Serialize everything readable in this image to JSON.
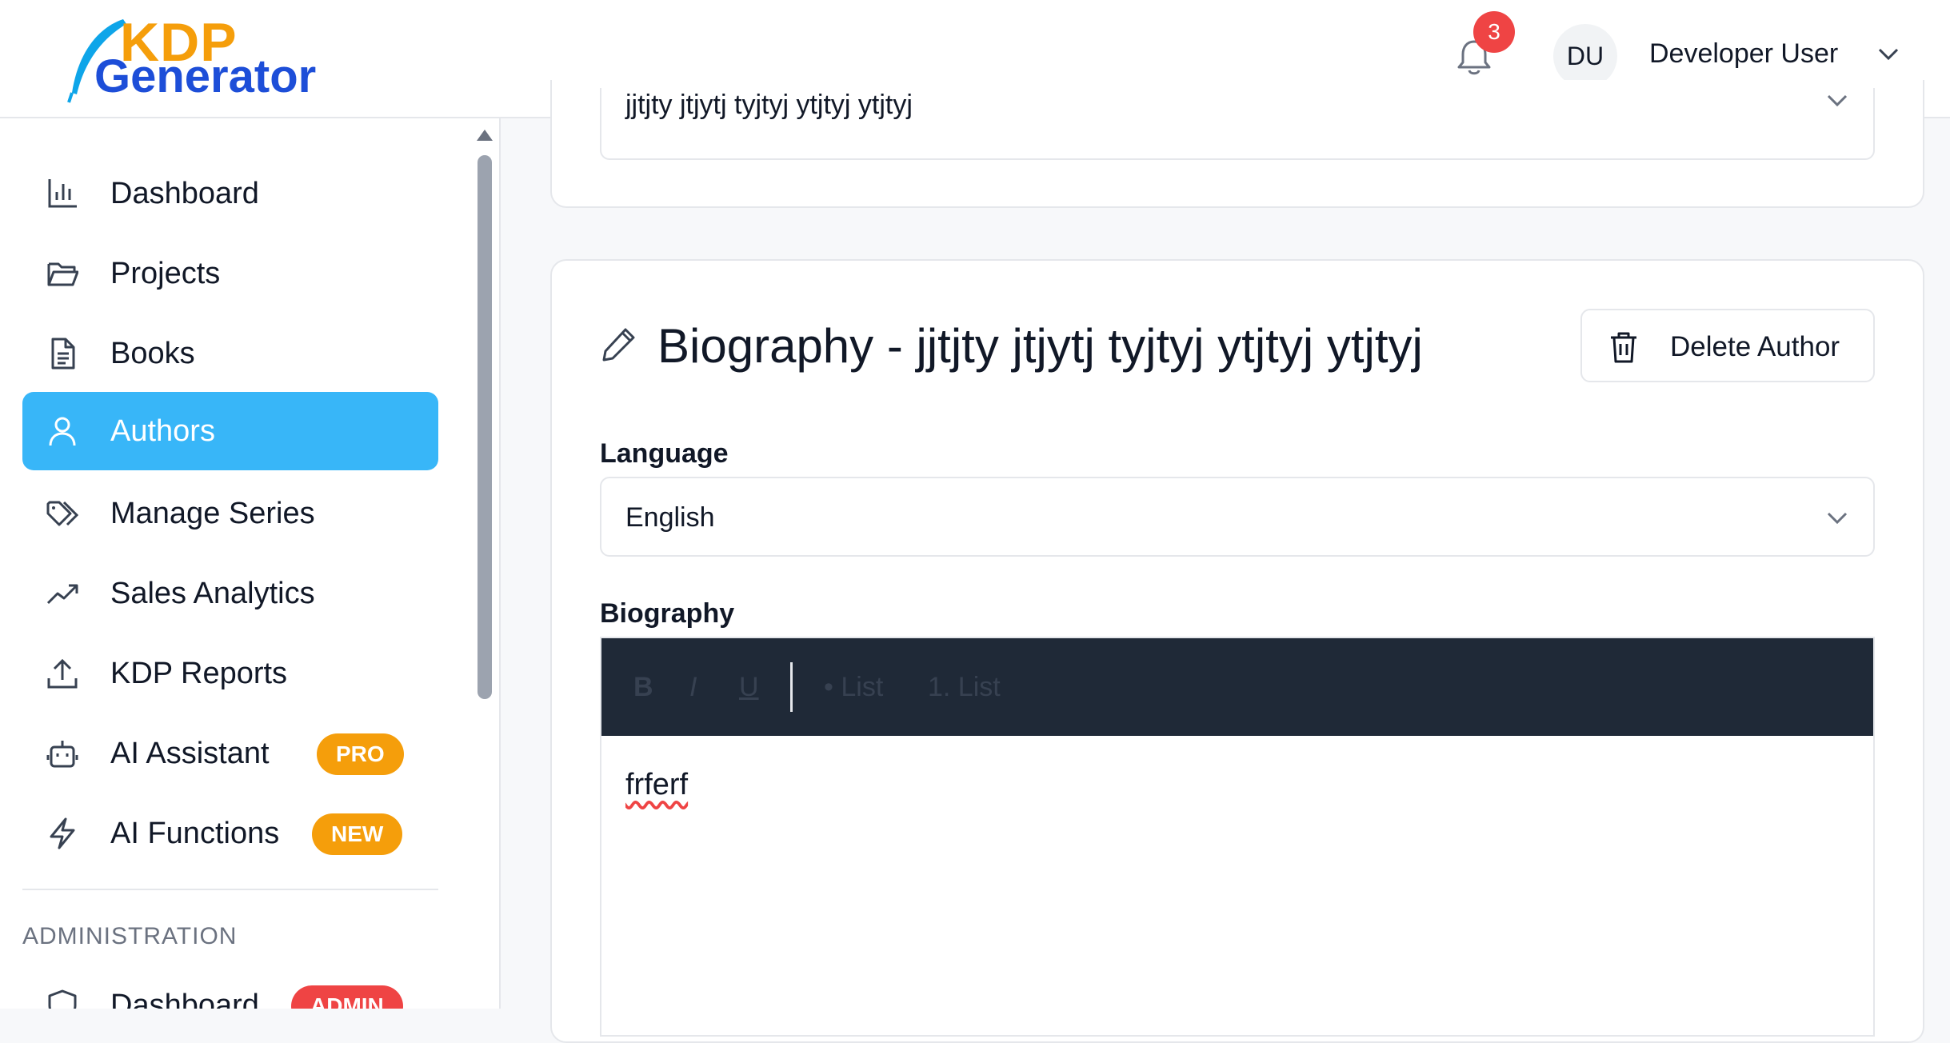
{
  "header": {
    "logo": {
      "line1": "KDP",
      "line2": "Generator"
    },
    "notifications_count": "3",
    "avatar_initials": "DU",
    "user_name": "Developer User"
  },
  "sidebar": {
    "items": [
      {
        "label": "Dashboard",
        "icon": "bar-chart-icon"
      },
      {
        "label": "Projects",
        "icon": "folder-open-icon"
      },
      {
        "label": "Books",
        "icon": "file-text-icon"
      },
      {
        "label": "Authors",
        "icon": "user-icon",
        "active": true
      },
      {
        "label": "Manage Series",
        "icon": "tags-icon"
      },
      {
        "label": "Sales Analytics",
        "icon": "trending-up-icon"
      },
      {
        "label": "KDP Reports",
        "icon": "upload-icon"
      },
      {
        "label": "AI Assistant",
        "icon": "robot-icon",
        "badge": "PRO"
      },
      {
        "label": "AI Functions",
        "icon": "lightning-icon",
        "badge": "NEW"
      }
    ],
    "section_label": "ADMINISTRATION",
    "admin_items": [
      {
        "label": "Dashboard",
        "icon": "shield-icon",
        "badge": "ADMIN"
      }
    ]
  },
  "main": {
    "top_select_value": "jjtjty jtjytj tyjtyj ytjtyj ytjtyj",
    "card": {
      "title": "Biography - jjtjty jtjytj tyjtyj ytjtyj ytjtyj",
      "delete_label": "Delete Author",
      "language_label": "Language",
      "language_value": "English",
      "biography_label": "Biography",
      "toolbar": {
        "bold": "B",
        "italic": "I",
        "underline": "U",
        "bullet_list": "• List",
        "numbered_list": "1. List"
      },
      "biography_text": "frferf"
    }
  },
  "colors": {
    "active_nav": "#38b6f8",
    "badge_pro": "#f59e0b",
    "badge_new": "#f59e0b",
    "badge_admin": "#ef4444",
    "toolbar_bg": "#1f2937",
    "notification_badge": "#ef4444"
  }
}
